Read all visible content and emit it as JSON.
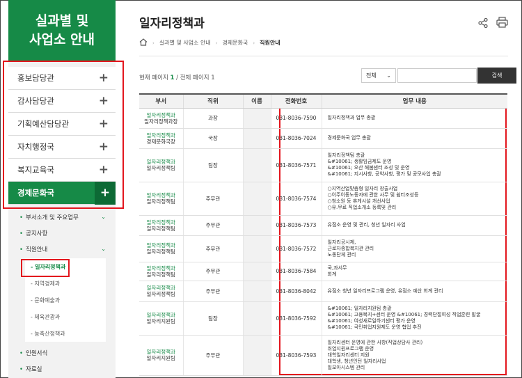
{
  "sidebar": {
    "title_line1": "실과별 및",
    "title_line2": "사업소 안내",
    "menu": [
      {
        "label": "홍보담당관",
        "icon": "+"
      },
      {
        "label": "감사담당관",
        "icon": "+"
      },
      {
        "label": "기획예산담당관",
        "icon": "+"
      },
      {
        "label": "자치행정국",
        "icon": "+"
      },
      {
        "label": "복지교육국",
        "icon": "+"
      },
      {
        "label": "경제문화국",
        "icon": "+"
      }
    ],
    "sub": [
      {
        "label": "부서소개 및 주요업무",
        "chev": "⌄"
      },
      {
        "label": "공지사항"
      },
      {
        "label": "직원안내",
        "chev": "⌄"
      }
    ],
    "subsub": [
      {
        "label": "- 일자리정책과"
      },
      {
        "label": "- 지역경제과"
      },
      {
        "label": "- 문화예술과"
      },
      {
        "label": "- 체육관광과"
      },
      {
        "label": "- 농축산정책과"
      }
    ],
    "sub_after": [
      {
        "label": "인원서식"
      },
      {
        "label": "자료실"
      }
    ]
  },
  "main": {
    "title": "일자리정책과",
    "breadcrumb": [
      "실과별 및 사업소 안내",
      "경제문화국",
      "직원안내"
    ],
    "count_prefix": "현재 페이지",
    "count_current": "1",
    "count_middle": "/ 전체 페이지",
    "count_total": "1",
    "select_value": "전체",
    "search_button": "검색",
    "icons": [
      "home-icon",
      "share-icon",
      "print-icon"
    ]
  },
  "table": {
    "headers": [
      "부서",
      "직위",
      "이름",
      "전화번호",
      "업무 내용"
    ],
    "rows": [
      {
        "dept1": "일자리정책과",
        "dept2": "일자리정책과장",
        "pos": "과장",
        "tel": "031-8036-7590",
        "duty": "일자리정책과 업무 총괄"
      },
      {
        "dept1": "일자리정책과",
        "dept2": "경제문화국장",
        "pos": "국장",
        "tel": "031-8036-7024",
        "duty": "경제문화국 업무 총괄"
      },
      {
        "dept1": "일자리정책과",
        "dept2": "일자리정책팀",
        "pos": "팀장",
        "tel": "031-8036-7571",
        "duty": "일자리정책팀 총괄\n&#10061; 생활임금제도 운영\n&#10061; 오산 해봄센터 조성 및 운영\n&#10061; 지시사항, 공약사항, 평가 및 공모사업 총괄"
      },
      {
        "dept1": "일자리정책과",
        "dept2": "일자리정책팀",
        "pos": "주무관",
        "tel": "031-8036-7574",
        "duty": "○지역산업맞춤형 일자리 창출사업\n○이주이동노동자에 관한 사무 및 쉼터조성등\n○청소원 등 휴게시설 개선사업\n○유.무료 직업소개소 등록및 관리"
      },
      {
        "dept1": "일자리정책과",
        "dept2": "일자리정책팀",
        "pos": "주무관",
        "tel": "031-8036-7573",
        "duty": "유점소 운영 및 관리, 청년 일자리 사업"
      },
      {
        "dept1": "일자리정책과",
        "dept2": "일자리정책팀",
        "pos": "주무관",
        "tel": "031-8036-7572",
        "duty": "일자리공시제,\n근로자종합복지관 관리\n노동단체 관리"
      },
      {
        "dept1": "일자리정책과",
        "dept2": "일자리정책팀",
        "pos": "주무관",
        "tel": "031-8036-7584",
        "duty": "국,과서무\n회계"
      },
      {
        "dept1": "일자리정책과",
        "dept2": "일자리정책팀",
        "pos": "주무관",
        "tel": "031-8036-8042",
        "duty": "유점소 청년 일자리프로그램 운영, 유점소 예산 회계 관리"
      },
      {
        "dept1": "일자리정책과",
        "dept2": "일자리지원팀",
        "pos": "팀장",
        "tel": "031-8036-7592",
        "duty": "&#10061; 일자리지원팀 총괄\n&#10061; 고용복지+센터 운영 &#10061; 경력단절여성 직업훈련 발굴\n&#10061; 여성새로일하기센터 평가 운영\n&#10061; 국민취업지원제도 운영 협업 추진"
      },
      {
        "dept1": "일자리정책과",
        "dept2": "일자리지원팀",
        "pos": "주무관",
        "tel": "031-8036-7593",
        "duty": "일자리센터 운영에 관한 사항(직업상담사 관리)\n취업지원프로그램 운영\n대학일자리센터 지원\n대학생, 청년인턴 일자리사업\n일모아시스템 관리"
      }
    ]
  },
  "colors": {
    "brand": "#168a47",
    "highlight": "#e3151d"
  }
}
